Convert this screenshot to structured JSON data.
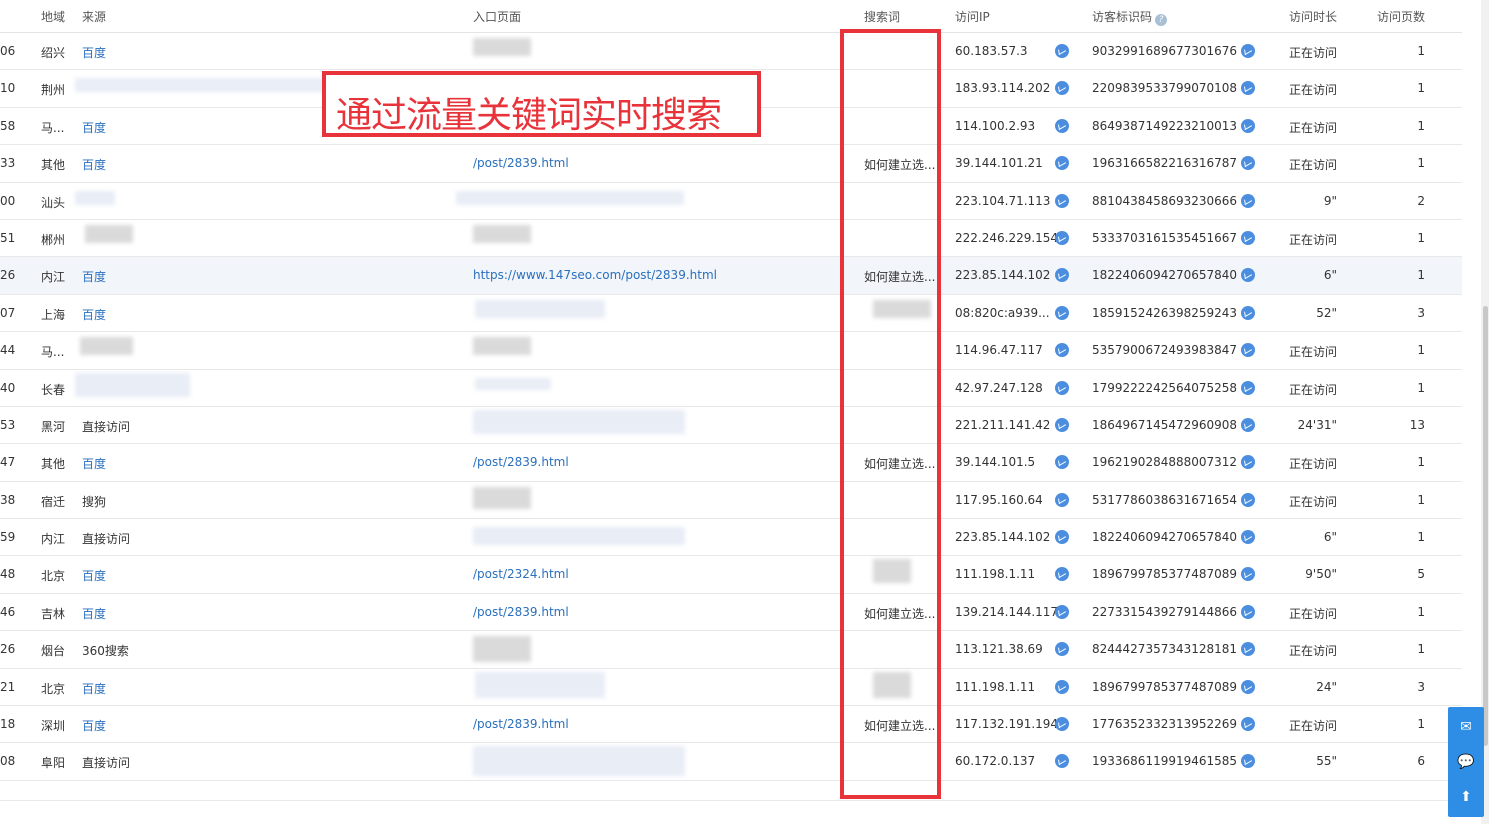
{
  "header": {
    "region": "地域",
    "source": "来源",
    "entry_page": "入口页面",
    "keyword": "搜索词",
    "ip": "访问IP",
    "visitor_id": "访客标识码",
    "duration": "访问时长",
    "pages": "访问页数"
  },
  "overlay": {
    "title": "通过流量关键词实时搜索"
  },
  "rows": [
    {
      "time": "06",
      "region": "绍兴",
      "source": "百度",
      "page": "",
      "keyword": "",
      "ip": "60.183.57.3",
      "vid": "9032991689677301676",
      "duration": "正在访问",
      "pages": "1"
    },
    {
      "time": "10",
      "region": "荆州",
      "source": "",
      "page": "",
      "keyword": "",
      "ip": "183.93.114.202",
      "vid": "2209839533799070108",
      "duration": "正在访问",
      "pages": "1"
    },
    {
      "time": "58",
      "region": "马...",
      "source": "百度",
      "page": "",
      "keyword": "",
      "ip": "114.100.2.93",
      "vid": "8649387149223210013",
      "duration": "正在访问",
      "pages": "1"
    },
    {
      "time": "33",
      "region": "其他",
      "source": "百度",
      "page": "/post/2839.html",
      "keyword": "如何建立选...",
      "ip": "39.144.101.21",
      "vid": "1963166582216316787",
      "duration": "正在访问",
      "pages": "1"
    },
    {
      "time": "00",
      "region": "汕头",
      "source": "",
      "page": "",
      "keyword": "",
      "ip": "223.104.71.113",
      "vid": "8810438458693230666",
      "duration": "9\"",
      "pages": "2"
    },
    {
      "time": "51",
      "region": "郴州",
      "source": "",
      "page": "",
      "keyword": "",
      "ip": "222.246.229.154",
      "vid": "5333703161535451667",
      "duration": "正在访问",
      "pages": "1"
    },
    {
      "time": "26",
      "region": "内江",
      "source": "百度",
      "page": "https://www.147seo.com/post/2839.html",
      "keyword": "如何建立选...",
      "ip": "223.85.144.102",
      "vid": "1822406094270657840",
      "duration": "6\"",
      "pages": "1"
    },
    {
      "time": "07",
      "region": "上海",
      "source": "百度",
      "page": "",
      "keyword": "",
      "ip": "08:820c:a939...",
      "vid": "1859152426398259243",
      "duration": "52\"",
      "pages": "3"
    },
    {
      "time": "44",
      "region": "马...",
      "source": "",
      "page": "",
      "keyword": "",
      "ip": "114.96.47.117",
      "vid": "5357900672493983847",
      "duration": "正在访问",
      "pages": "1"
    },
    {
      "time": "40",
      "region": "长春",
      "source": "",
      "page": "",
      "keyword": "",
      "ip": "42.97.247.128",
      "vid": "1799222242564075258",
      "duration": "正在访问",
      "pages": "1"
    },
    {
      "time": "53",
      "region": "黑河",
      "source": "直接访问",
      "page": "",
      "keyword": "",
      "ip": "221.211.141.42",
      "vid": "1864967145472960908",
      "duration": "24'31\"",
      "pages": "13"
    },
    {
      "time": "47",
      "region": "其他",
      "source": "百度",
      "page": "/post/2839.html",
      "keyword": "如何建立选...",
      "ip": "39.144.101.5",
      "vid": "1962190284888007312",
      "duration": "正在访问",
      "pages": "1"
    },
    {
      "time": "38",
      "region": "宿迁",
      "source": "搜狗",
      "page": "",
      "keyword": "",
      "ip": "117.95.160.64",
      "vid": "5317786038631671654",
      "duration": "正在访问",
      "pages": "1"
    },
    {
      "time": "59",
      "region": "内江",
      "source": "直接访问",
      "page": "",
      "keyword": "",
      "ip": "223.85.144.102",
      "vid": "1822406094270657840",
      "duration": "6\"",
      "pages": "1"
    },
    {
      "time": "48",
      "region": "北京",
      "source": "百度",
      "page": "/post/2324.html",
      "keyword": "",
      "ip": "111.198.1.11",
      "vid": "1896799785377487089",
      "duration": "9'50\"",
      "pages": "5"
    },
    {
      "time": "46",
      "region": "吉林",
      "source": "百度",
      "page": "/post/2839.html",
      "keyword": "如何建立选...",
      "ip": "139.214.144.117",
      "vid": "2273315439279144866",
      "duration": "正在访问",
      "pages": "1"
    },
    {
      "time": "26",
      "region": "烟台",
      "source": "360搜索",
      "page": "",
      "keyword": "",
      "ip": "113.121.38.69",
      "vid": "8244427357343128181",
      "duration": "正在访问",
      "pages": "1"
    },
    {
      "time": "21",
      "region": "北京",
      "source": "百度",
      "page": "",
      "keyword": "",
      "ip": "111.198.1.11",
      "vid": "1896799785377487089",
      "duration": "24\"",
      "pages": "3"
    },
    {
      "time": "18",
      "region": "深圳",
      "source": "百度",
      "page": "/post/2839.html",
      "keyword": "如何建立选...",
      "ip": "117.132.191.194",
      "vid": "1776352332313952269",
      "duration": "正在访问",
      "pages": "1"
    },
    {
      "time": "08",
      "region": "阜阳",
      "source": "直接访问",
      "page": "",
      "keyword": "",
      "ip": "60.172.0.137",
      "vid": "1933686119919461585",
      "duration": "55\"",
      "pages": "6"
    }
  ],
  "colors": {
    "accent": "#e8333a",
    "link": "#2a6fbd",
    "float": "#2e8ee5"
  },
  "icons": {
    "trend": "trend-chart-icon",
    "help": "question-icon",
    "mail": "mail-icon",
    "wechat": "wechat-icon",
    "top": "back-to-top-icon"
  }
}
